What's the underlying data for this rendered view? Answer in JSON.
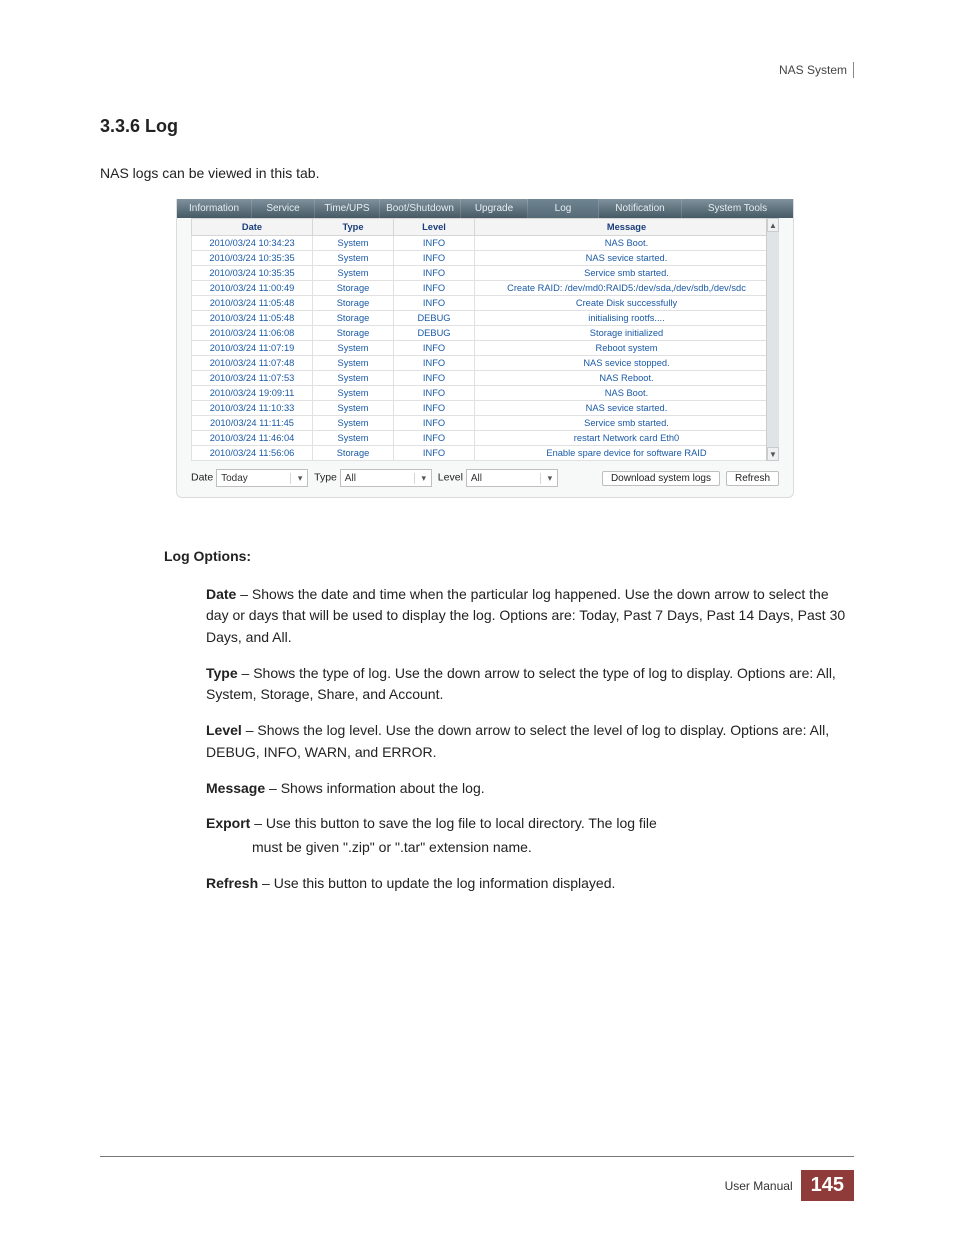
{
  "header": {
    "doc_name": "NAS System"
  },
  "section": {
    "number_title": "3.3.6  Log",
    "intro": "NAS logs can be viewed in this tab."
  },
  "screenshot": {
    "tabs": [
      "Information",
      "Service",
      "Time/UPS",
      "Boot/Shutdown",
      "Upgrade",
      "Log",
      "Notification",
      "System Tools"
    ],
    "columns": {
      "date": "Date",
      "type": "Type",
      "level": "Level",
      "message": "Message"
    },
    "rows": [
      {
        "date": "2010/03/24 10:34:23",
        "type": "System",
        "level": "INFO",
        "message": "NAS Boot."
      },
      {
        "date": "2010/03/24 10:35:35",
        "type": "System",
        "level": "INFO",
        "message": "NAS sevice started."
      },
      {
        "date": "2010/03/24 10:35:35",
        "type": "System",
        "level": "INFO",
        "message": "Service smb started."
      },
      {
        "date": "2010/03/24 11:00:49",
        "type": "Storage",
        "level": "INFO",
        "message": "Create RAID: /dev/md0:RAID5:/dev/sda,/dev/sdb,/dev/sdc"
      },
      {
        "date": "2010/03/24 11:05:48",
        "type": "Storage",
        "level": "INFO",
        "message": "Create Disk successfully"
      },
      {
        "date": "2010/03/24 11:05:48",
        "type": "Storage",
        "level": "DEBUG",
        "message": "initialising rootfs...."
      },
      {
        "date": "2010/03/24 11:06:08",
        "type": "Storage",
        "level": "DEBUG",
        "message": "Storage initialized"
      },
      {
        "date": "2010/03/24 11:07:19",
        "type": "System",
        "level": "INFO",
        "message": "Reboot system"
      },
      {
        "date": "2010/03/24 11:07:48",
        "type": "System",
        "level": "INFO",
        "message": "NAS sevice stopped."
      },
      {
        "date": "2010/03/24 11:07:53",
        "type": "System",
        "level": "INFO",
        "message": "NAS Reboot."
      },
      {
        "date": "2010/03/24 19:09:11",
        "type": "System",
        "level": "INFO",
        "message": "NAS Boot."
      },
      {
        "date": "2010/03/24 11:10:33",
        "type": "System",
        "level": "INFO",
        "message": "NAS sevice started."
      },
      {
        "date": "2010/03/24 11:11:45",
        "type": "System",
        "level": "INFO",
        "message": "Service smb started."
      },
      {
        "date": "2010/03/24 11:46:04",
        "type": "System",
        "level": "INFO",
        "message": "restart Network card Eth0"
      },
      {
        "date": "2010/03/24 11:56:06",
        "type": "Storage",
        "level": "INFO",
        "message": "Enable spare device for software RAID"
      }
    ],
    "filter": {
      "date_label": "Date",
      "date_value": "Today",
      "type_label": "Type",
      "type_value": "All",
      "level_label": "Level",
      "level_value": "All",
      "download_btn": "Download system logs",
      "refresh_btn": "Refresh"
    }
  },
  "options": {
    "heading": "Log Options:",
    "date_lead": "Date",
    "date_body": " – Shows the date and time when the particular log happened. Use the down arrow to select the day or days that will be used to display the log. Options are: Today, Past 7 Days, Past 14 Days, Past 30 Days, and All.",
    "type_lead": "Type",
    "type_body": " – Shows the type of log. Use the down arrow to select the type of log to display. Options are: All, System, Storage, Share, and Account.",
    "level_lead": "Level",
    "level_body": " – Shows the log level. Use the down arrow to select the level of log to display. Options are: All, DEBUG, INFO, WARN, and ERROR.",
    "message_lead": "Message",
    "message_body": " – Shows information about the log.",
    "export_lead": "Export",
    "export_body1": " – Use this button to save the log file to local directory. The log file",
    "export_body2": "must be given \".zip\" or \".tar\" extension name.",
    "refresh_lead": "Refresh",
    "refresh_body": " – Use this button to update the log information displayed."
  },
  "footer": {
    "manual": "User Manual",
    "page": "145"
  }
}
